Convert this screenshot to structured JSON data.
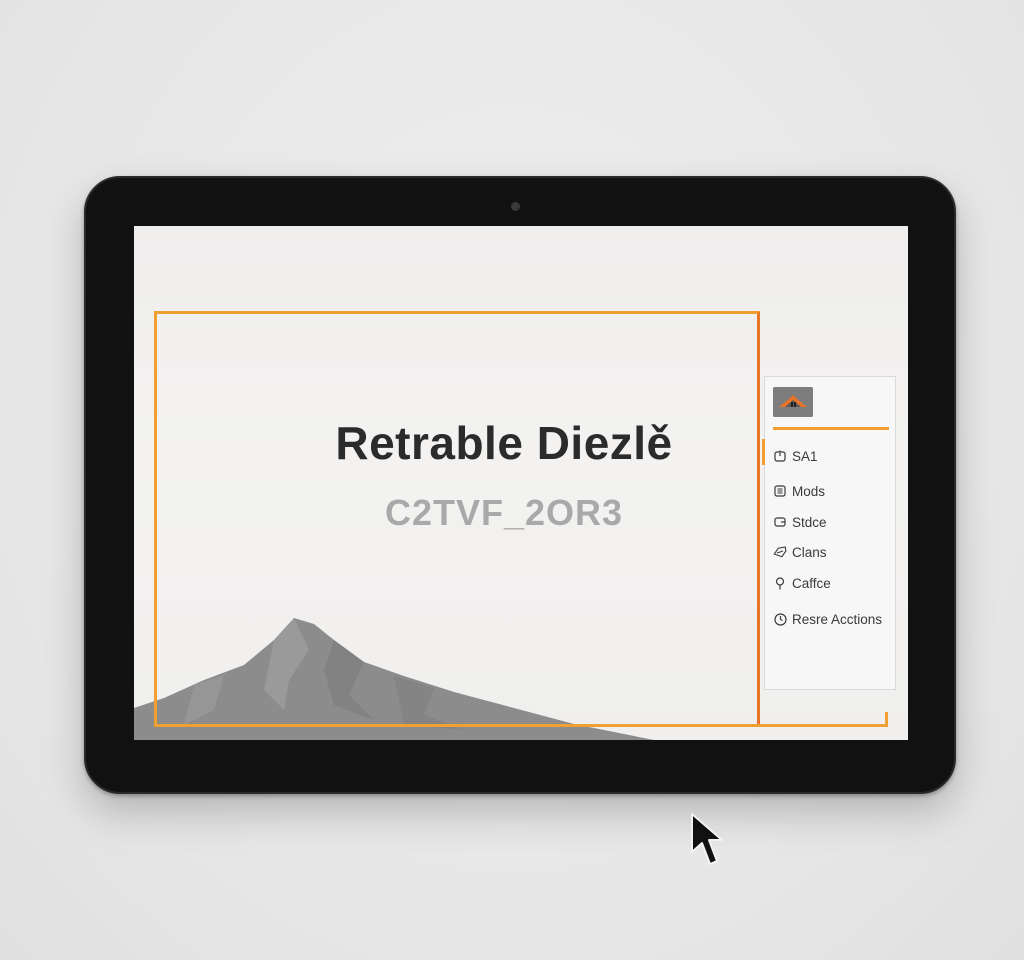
{
  "screen": {
    "title": "Retrable Diezlě",
    "subtitle": "C2TVF_2OR3"
  },
  "side_panel": {
    "thumbnail_icon": "mountain-thumbnail",
    "items": [
      {
        "label": "SA1",
        "icon": "timer-icon"
      },
      {
        "label": "Mods",
        "icon": "list-icon"
      },
      {
        "label": "Stdce",
        "icon": "card-icon"
      },
      {
        "label": "Clans",
        "icon": "tag-icon"
      },
      {
        "label": "Caffce",
        "icon": "pin-icon"
      },
      {
        "label": "Resre Acctions",
        "icon": "clock-icon"
      }
    ]
  },
  "colors": {
    "accent": "#f0a030",
    "accent_dark": "#e8742a",
    "bezel": "#111111",
    "title_text": "#2b2b2b",
    "subtitle_text": "#a9a9a9"
  }
}
